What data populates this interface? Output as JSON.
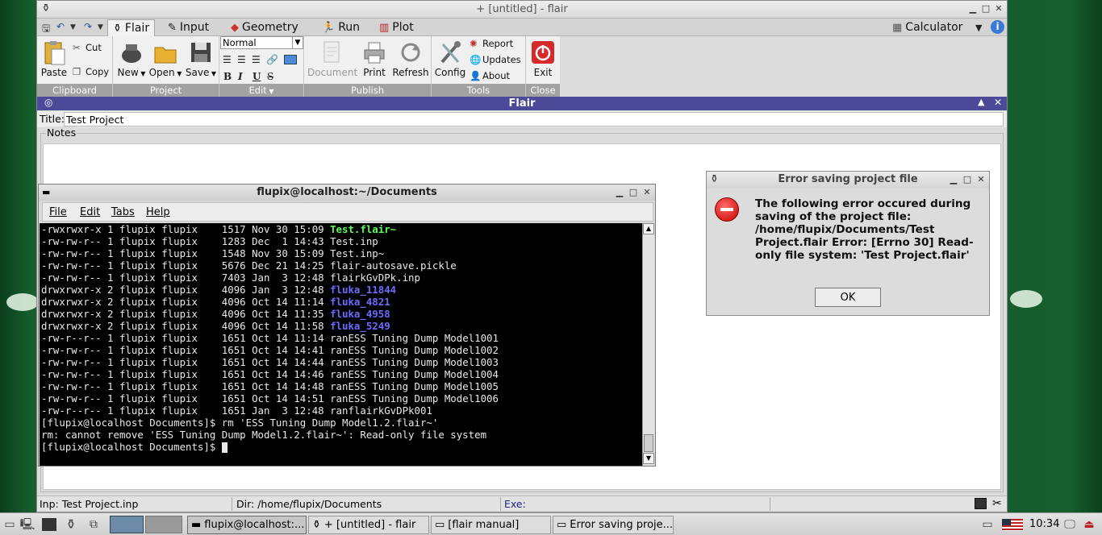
{
  "app": {
    "title": "+ [untitled] - flair",
    "ctl_min": "▁",
    "ctl_max": "□",
    "ctl_close": "✕"
  },
  "tabs": {
    "flair": "Flair",
    "input": "Input",
    "geometry": "Geometry",
    "run": "Run",
    "plot": "Plot",
    "calculator": "Calculator"
  },
  "ribbon": {
    "clipboard": {
      "label": "Clipboard",
      "paste": "Paste",
      "cut": "Cut",
      "copy": "Copy"
    },
    "project": {
      "label": "Project",
      "new": "New",
      "open": "Open",
      "save": "Save"
    },
    "edit": {
      "label": "Edit",
      "style_select": "Normal",
      "bold": "B",
      "italic": "I",
      "underline": "U",
      "strike": "S"
    },
    "publish": {
      "label": "Publish",
      "document": "Document",
      "print": "Print",
      "refresh": "Refresh"
    },
    "tools": {
      "label": "Tools",
      "config": "Config",
      "report": "Report",
      "updates": "Updates",
      "about": "About"
    },
    "close": {
      "label": "Close",
      "exit": "Exit"
    }
  },
  "panel": {
    "header": "Flair",
    "title_label": "Title:",
    "title_value": "Test Project",
    "notes_label": "Notes"
  },
  "status": {
    "inp": "Inp: Test Project.inp",
    "dir": "Dir: /home/flupix/Documents",
    "exe": "Exe:"
  },
  "terminal": {
    "title": "flupix@localhost:~/Documents",
    "menu": {
      "file": "File",
      "edit": "Edit",
      "tabs": "Tabs",
      "help": "Help"
    },
    "lines": [
      {
        "prefix": "-rwxrwxr-x 1 flupix flupix    1517 Nov 30 15:09 ",
        "name": "Test.flair~",
        "style": "green"
      },
      {
        "prefix": "-rw-rw-r-- 1 flupix flupix    1283 Dec  1 14:43 ",
        "name": "Test.inp",
        "style": ""
      },
      {
        "prefix": "-rw-rw-r-- 1 flupix flupix    1548 Nov 30 15:09 ",
        "name": "Test.inp~",
        "style": ""
      },
      {
        "prefix": "-rw-rw-r-- 1 flupix flupix    5676 Dec 21 14:25 ",
        "name": "flair-autosave.pickle",
        "style": ""
      },
      {
        "prefix": "-rw-rw-r-- 1 flupix flupix    7403 Jan  3 12:48 ",
        "name": "flairkGvDPk.inp",
        "style": ""
      },
      {
        "prefix": "drwxrwxr-x 2 flupix flupix    4096 Jan  3 12:48 ",
        "name": "fluka_11844",
        "style": "blue"
      },
      {
        "prefix": "drwxrwxr-x 2 flupix flupix    4096 Oct 14 11:14 ",
        "name": "fluka_4821",
        "style": "blue"
      },
      {
        "prefix": "drwxrwxr-x 2 flupix flupix    4096 Oct 14 11:35 ",
        "name": "fluka_4958",
        "style": "blue"
      },
      {
        "prefix": "drwxrwxr-x 2 flupix flupix    4096 Oct 14 11:58 ",
        "name": "fluka_5249",
        "style": "blue"
      },
      {
        "prefix": "-rw-r--r-- 1 flupix flupix    1651 Oct 14 11:14 ",
        "name": "ranESS Tuning Dump Model1001",
        "style": ""
      },
      {
        "prefix": "-rw-rw-r-- 1 flupix flupix    1651 Oct 14 14:41 ",
        "name": "ranESS Tuning Dump Model1002",
        "style": ""
      },
      {
        "prefix": "-rw-rw-r-- 1 flupix flupix    1651 Oct 14 14:44 ",
        "name": "ranESS Tuning Dump Model1003",
        "style": ""
      },
      {
        "prefix": "-rw-rw-r-- 1 flupix flupix    1651 Oct 14 14:46 ",
        "name": "ranESS Tuning Dump Model1004",
        "style": ""
      },
      {
        "prefix": "-rw-rw-r-- 1 flupix flupix    1651 Oct 14 14:48 ",
        "name": "ranESS Tuning Dump Model1005",
        "style": ""
      },
      {
        "prefix": "-rw-rw-r-- 1 flupix flupix    1651 Oct 14 14:51 ",
        "name": "ranESS Tuning Dump Model1006",
        "style": ""
      },
      {
        "prefix": "-rw-r--r-- 1 flupix flupix    1651 Jan  3 12:48 ",
        "name": "ranflairkGvDPk001",
        "style": ""
      },
      {
        "prefix": "[flupix@localhost Documents]$ rm 'ESS Tuning Dump Model1.2.flair~'",
        "name": "",
        "style": ""
      },
      {
        "prefix": "rm: cannot remove 'ESS Tuning Dump Model1.2.flair~': Read-only file system",
        "name": "",
        "style": ""
      }
    ],
    "prompt": "[flupix@localhost Documents]$ "
  },
  "dialog": {
    "title": "Error saving project file",
    "message": "The following error occured during saving of the project file: /home/flupix/Documents/Test Project.flair Error: [Errno 30] Read-only file system: 'Test Project.flair'",
    "ok": "OK"
  },
  "taskbar": {
    "items": [
      {
        "label": "flupix@localhost:...",
        "active": true
      },
      {
        "label": "+ [untitled] - flair",
        "active": false
      },
      {
        "label": "[flair manual]",
        "active": false
      },
      {
        "label": "Error saving proje...",
        "active": false
      }
    ],
    "clock": "10:34"
  },
  "colors": {
    "accent_bar": "#4c4a98",
    "desktop": "#17602e",
    "term_dir": "#6b6bff",
    "term_exec": "#5dfc5d"
  }
}
